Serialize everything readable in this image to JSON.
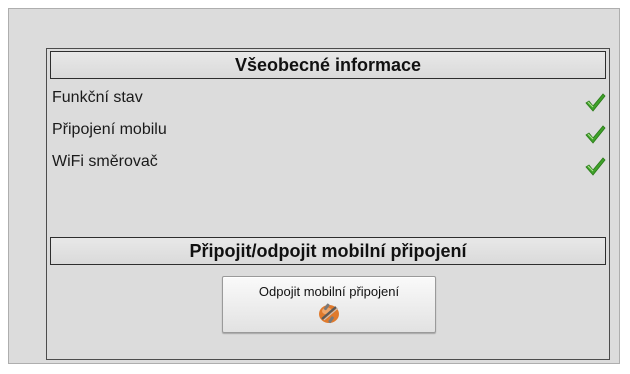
{
  "general_info": {
    "title": "Všeobecné informace",
    "items": [
      {
        "label": "Funkční stav",
        "status": "ok"
      },
      {
        "label": "Připojení mobilu",
        "status": "ok"
      },
      {
        "label": "WiFi směrovač",
        "status": "ok"
      }
    ]
  },
  "mobile_connection": {
    "title": "Připojit/odpojit mobilní připojení",
    "disconnect_label": "Odpojit mobilní připojení",
    "disconnect_icon": "unplug-icon"
  },
  "colors": {
    "background": "#dcdcdc",
    "check_green": "#3fa12a"
  }
}
